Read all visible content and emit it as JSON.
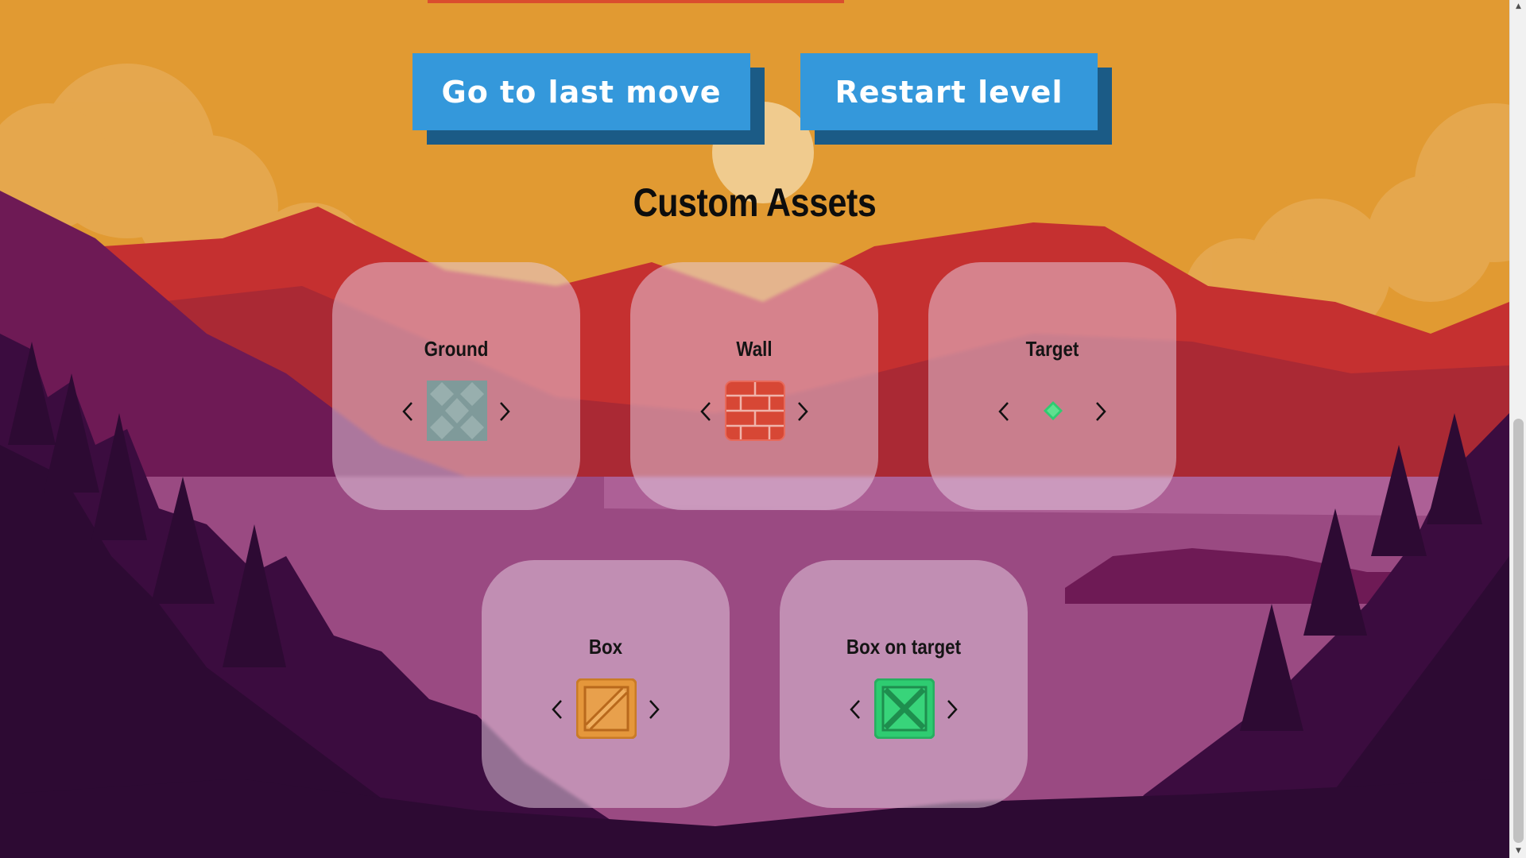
{
  "buttons": {
    "last_move": "Go to last move",
    "restart": "Restart level"
  },
  "section_title": "Custom Assets",
  "assets": [
    {
      "label": "Ground",
      "icon": "ground-tile-icon"
    },
    {
      "label": "Wall",
      "icon": "wall-tile-icon"
    },
    {
      "label": "Target",
      "icon": "target-tile-icon"
    },
    {
      "label": "Box",
      "icon": "box-tile-icon"
    },
    {
      "label": "Box on target",
      "icon": "box-on-target-tile-icon"
    }
  ],
  "colors": {
    "sky": "#e19a32",
    "button": "#3498db",
    "button_shadow": "#1b5b86",
    "mountain": "#c53030",
    "forest": "#2d0a33",
    "lake": "#9a4a82"
  }
}
